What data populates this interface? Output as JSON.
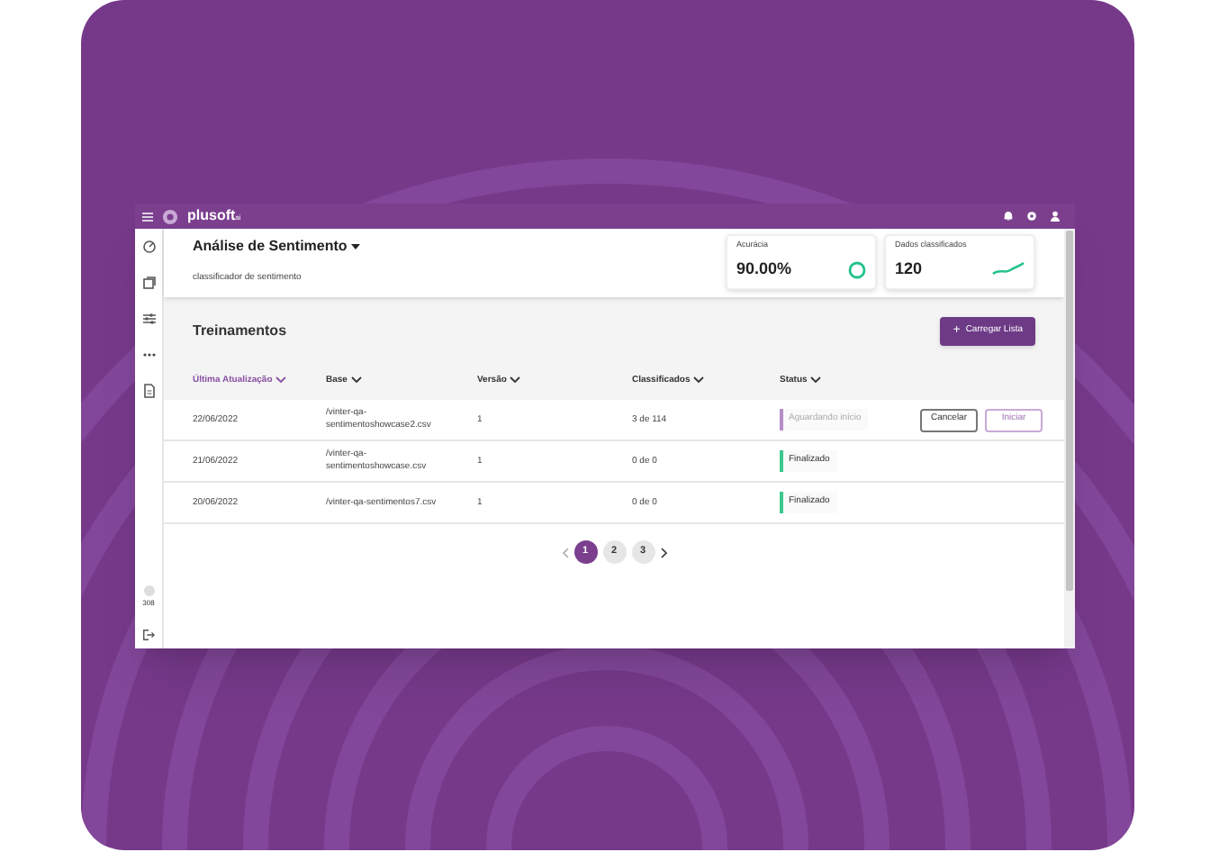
{
  "topbar": {
    "logo": "plusoft",
    "logo_suffix": "ai"
  },
  "sidebar": {
    "badge_text": "308"
  },
  "header": {
    "title": "Análise de Sentimento",
    "subtitle": "classificador de sentimento"
  },
  "metrics": [
    {
      "label": "Acurácia",
      "value": "90.00%",
      "kind": "ring"
    },
    {
      "label": "Dados classificados",
      "value": "120",
      "kind": "trend"
    }
  ],
  "section": {
    "title": "Treinamentos",
    "action": "Carregar Lista",
    "action_icon": "+"
  },
  "table": {
    "columns": [
      {
        "label": "Última Atualização",
        "selected": true
      },
      {
        "label": "Base",
        "selected": false
      },
      {
        "label": "Versão",
        "selected": false
      },
      {
        "label": "Classificados",
        "selected": false
      },
      {
        "label": "Status",
        "selected": false
      }
    ],
    "rows": [
      {
        "date": "22/06/2022",
        "base": "/vinter-qa-sentimentoshowcase2.csv",
        "version": "1",
        "classified": "3 de 114",
        "status": "Aguardando início",
        "color": "#b48cc8",
        "pending": true,
        "actions": [
          "Cancelar",
          "Iniciar"
        ]
      },
      {
        "date": "21/06/2022",
        "base": "/vinter-qa-sentimentoshowcase.csv",
        "version": "1",
        "classified": "0 de 0",
        "status": "Finalizado",
        "color": "#3cc88c",
        "pending": false,
        "actions": []
      },
      {
        "date": "20/06/2022",
        "base": "/vinter-qa-sentimentos7.csv",
        "version": "1",
        "classified": "0 de 0",
        "status": "Finalizado",
        "color": "#3cc88c",
        "pending": false,
        "actions": []
      }
    ]
  },
  "pagination": {
    "pages": [
      {
        "label": "1",
        "selected": true
      },
      {
        "label": "2",
        "selected": false
      },
      {
        "label": "3",
        "selected": false
      }
    ]
  }
}
